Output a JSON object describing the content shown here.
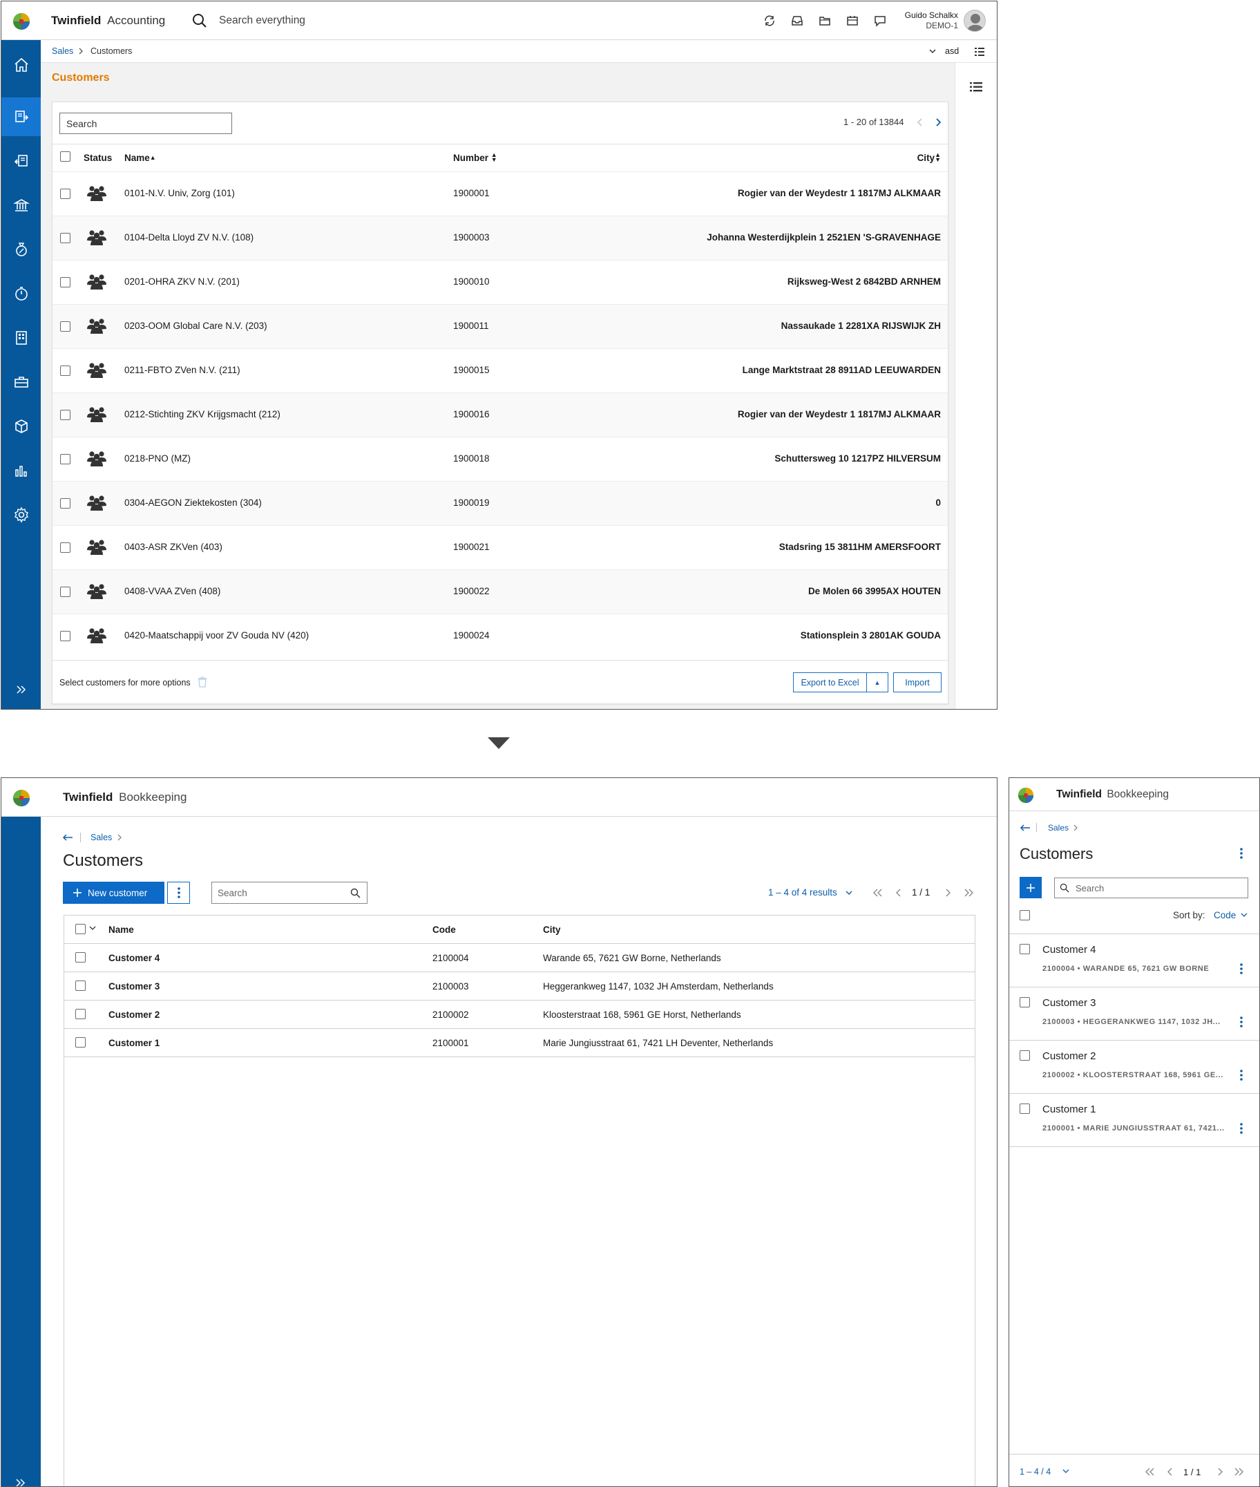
{
  "accounting": {
    "brand_bold": "Twinfield",
    "brand_light": "Accounting",
    "search_placeholder": "Search everything",
    "user_name": "Guido Schalkx",
    "user_company": "DEMO-1",
    "breadcrumb": {
      "sales": "Sales",
      "current": "Customers"
    },
    "office_label": "asd",
    "page_title": "Customers",
    "list_search_placeholder": "Search",
    "pagination_text": "1 - 20 of 13844",
    "columns": {
      "status": "Status",
      "name": "Name",
      "number": "Number",
      "city": "City"
    },
    "rows": [
      {
        "name": "0101-N.V. Univ, Zorg (101)",
        "number": "1900001",
        "city": "Rogier van der Weydestr 1 1817MJ ALKMAAR"
      },
      {
        "name": "0104-Delta Lloyd ZV N.V. (108)",
        "number": "1900003",
        "city": "Johanna Westerdijkplein 1 2521EN 'S-GRAVENHAGE"
      },
      {
        "name": "0201-OHRA ZKV N.V. (201)",
        "number": "1900010",
        "city": "Rijksweg-West 2 6842BD ARNHEM"
      },
      {
        "name": "0203-OOM Global Care N.V. (203)",
        "number": "1900011",
        "city": "Nassaukade 1 2281XA RIJSWIJK ZH"
      },
      {
        "name": "0211-FBTO ZVen N.V. (211)",
        "number": "1900015",
        "city": "Lange Marktstraat 28 8911AD LEEUWARDEN"
      },
      {
        "name": "0212-Stichting ZKV Krijgsmacht (212)",
        "number": "1900016",
        "city": "Rogier van der Weydestr 1 1817MJ ALKMAAR"
      },
      {
        "name": "0218-PNO (MZ)",
        "number": "1900018",
        "city": "Schuttersweg 10 1217PZ HILVERSUM"
      },
      {
        "name": "0304-AEGON Ziektekosten (304)",
        "number": "1900019",
        "city": "0"
      },
      {
        "name": "0403-ASR ZKVen (403)",
        "number": "1900021",
        "city": "Stadsring 15 3811HM AMERSFOORT"
      },
      {
        "name": "0408-VVAA ZVen (408)",
        "number": "1900022",
        "city": "De Molen 66 3995AX HOUTEN"
      },
      {
        "name": "0420-Maatschappij voor ZV Gouda NV (420)",
        "number": "1900024",
        "city": "Stationsplein 3 2801AK GOUDA"
      }
    ],
    "footer_hint": "Select customers for more options",
    "export_label": "Export to Excel",
    "import_label": "Import",
    "colors": {
      "sidebar": "#07589b",
      "sidebar_active": "#1677d2",
      "title_orange": "#e07b00",
      "link_blue": "#0d5ea9"
    }
  },
  "bookkeeping": {
    "brand_bold": "Twinfield",
    "brand_light": "Bookkeeping",
    "breadcrumb_sales": "Sales",
    "page_title": "Customers",
    "new_customer_label": "New customer",
    "search_placeholder": "Search",
    "results_text": "1 – 4 of 4 results",
    "page_indicator": "1 / 1",
    "columns": {
      "name": "Name",
      "code": "Code",
      "city": "City"
    },
    "rows": [
      {
        "name": "Customer 4",
        "code": "2100004",
        "city": "Warande 65, 7621 GW Borne, Netherlands"
      },
      {
        "name": "Customer 3",
        "code": "2100003",
        "city": "Heggerankweg 1147, 1032 JH Amsterdam, Netherlands"
      },
      {
        "name": "Customer 2",
        "code": "2100002",
        "city": "Kloosterstraat 168, 5961 GE Horst, Netherlands"
      },
      {
        "name": "Customer 1",
        "code": "2100001",
        "city": "Marie Jungiusstraat 61, 7421 LH Deventer, Netherlands"
      }
    ]
  },
  "mobile": {
    "brand_bold": "Twinfield",
    "brand_light": "Bookkeeping",
    "breadcrumb_sales": "Sales",
    "page_title": "Customers",
    "search_placeholder": "Search",
    "sort_label": "Sort by:",
    "sort_value": "Code",
    "items": [
      {
        "name": "Customer 4",
        "detail": "2100004 • WARANDE 65, 7621 GW BORNE"
      },
      {
        "name": "Customer 3",
        "detail": "2100003 • HEGGERANKWEG 1147, 1032 JH..."
      },
      {
        "name": "Customer 2",
        "detail": "2100002 • KLOOSTERSTRAAT 168, 5961 GE..."
      },
      {
        "name": "Customer 1",
        "detail": "2100001 • MARIE JUNGIUSSTRAAT 61, 7421..."
      }
    ],
    "results_text": "1 – 4 / 4",
    "page_indicator": "1 / 1"
  }
}
